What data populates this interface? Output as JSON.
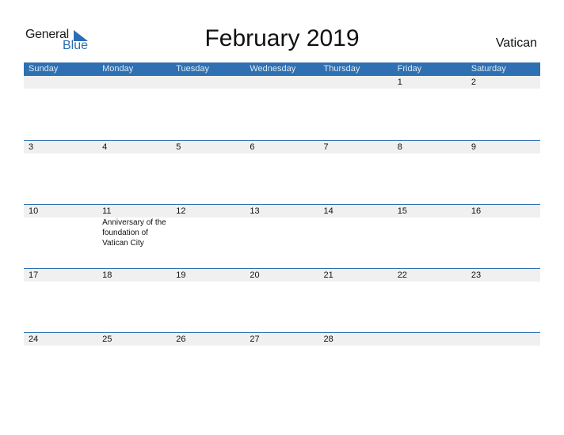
{
  "logo": {
    "line1": "General",
    "line2": "Blue"
  },
  "title": "February 2019",
  "country": "Vatican",
  "colors": {
    "header_bg": "#2e70b1",
    "strip_bg": "#f0f0f0",
    "logo_blue": "#2a6fb5"
  },
  "weekdays": [
    "Sunday",
    "Monday",
    "Tuesday",
    "Wednesday",
    "Thursday",
    "Friday",
    "Saturday"
  ],
  "weeks": [
    {
      "days": [
        "",
        "",
        "",
        "",
        "",
        "1",
        "2"
      ]
    },
    {
      "days": [
        "3",
        "4",
        "5",
        "6",
        "7",
        "8",
        "9"
      ]
    },
    {
      "days": [
        "10",
        "11",
        "12",
        "13",
        "14",
        "15",
        "16"
      ]
    },
    {
      "days": [
        "17",
        "18",
        "19",
        "20",
        "21",
        "22",
        "23"
      ]
    },
    {
      "days": [
        "24",
        "25",
        "26",
        "27",
        "28",
        "",
        ""
      ]
    }
  ],
  "events": [
    {
      "week": 2,
      "day": 1,
      "text": "Anniversary of the foundation of Vatican City"
    }
  ]
}
